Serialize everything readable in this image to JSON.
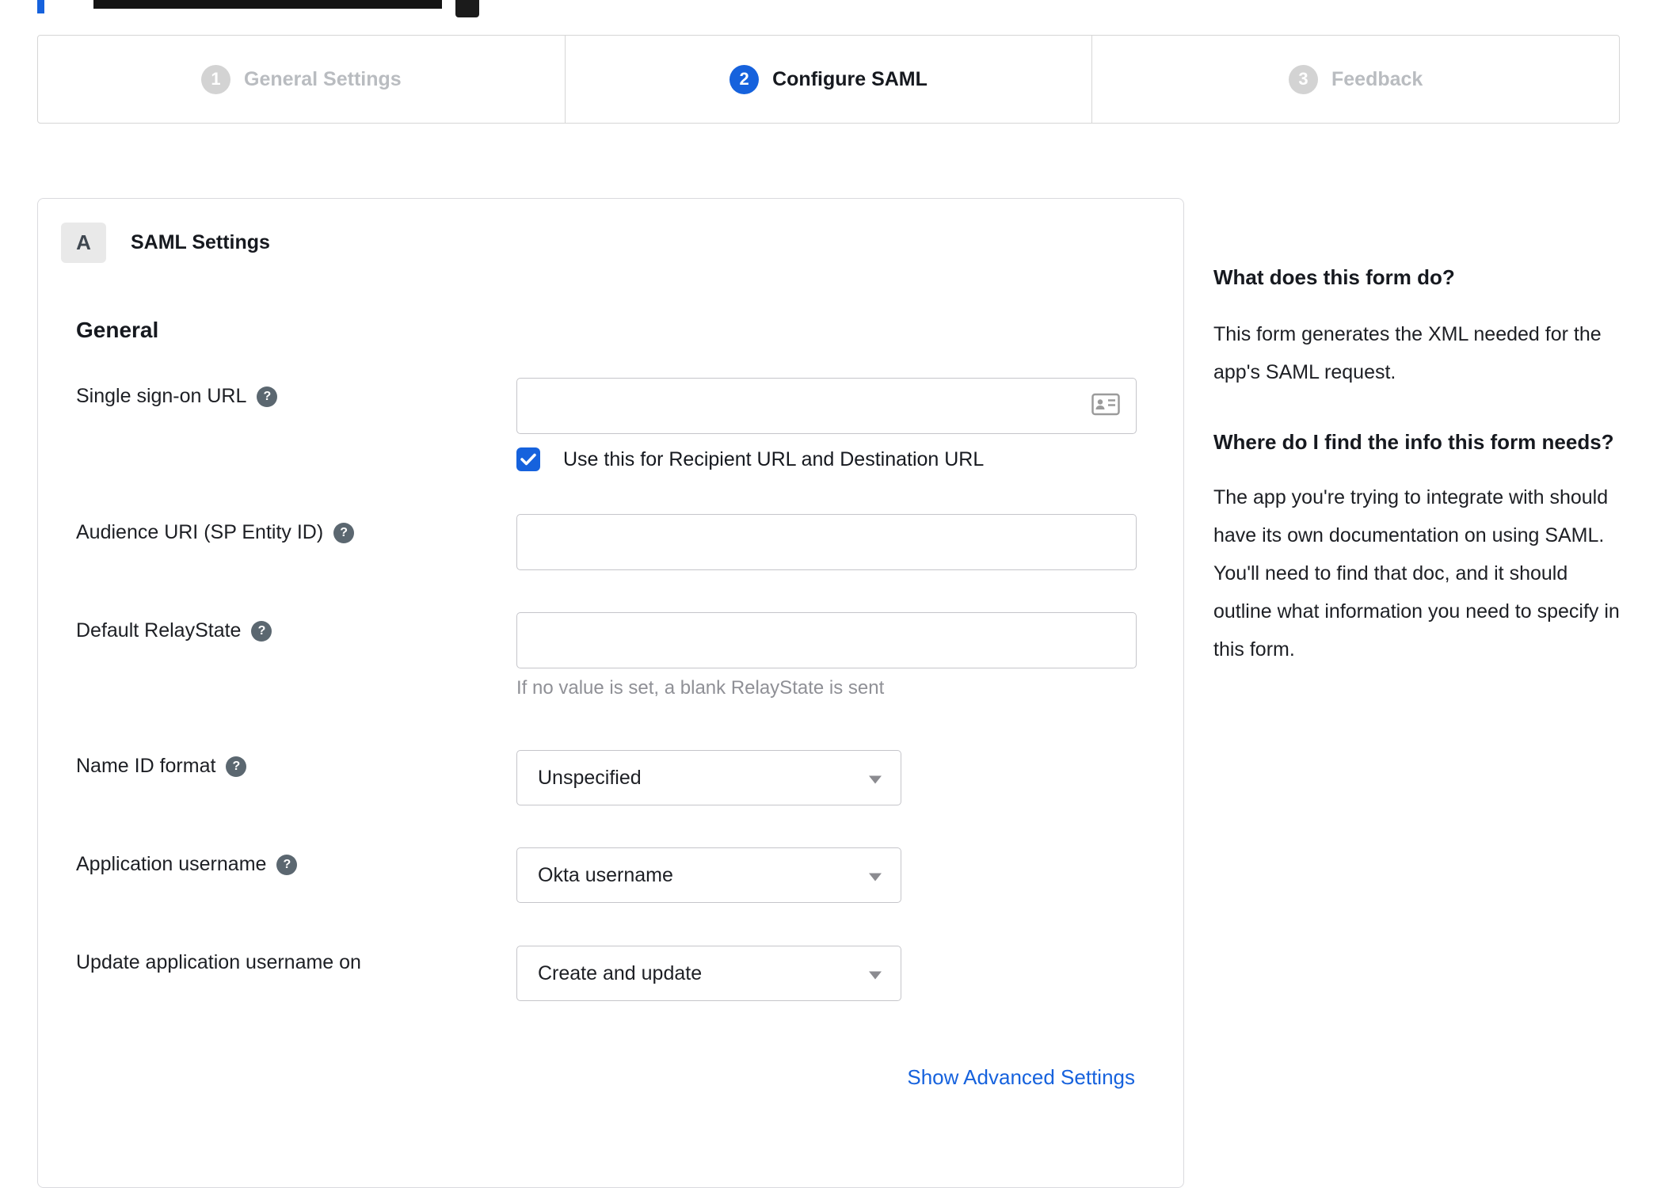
{
  "colors": {
    "accent": "#1662dd",
    "inactive_gray": "#b9bcc0"
  },
  "stepper": {
    "steps": [
      {
        "number": "1",
        "label": "General Settings",
        "active": false
      },
      {
        "number": "2",
        "label": "Configure SAML",
        "active": true
      },
      {
        "number": "3",
        "label": "Feedback",
        "active": false
      }
    ]
  },
  "panel": {
    "badge": "A",
    "title": "SAML Settings",
    "section": "General",
    "fields": {
      "sso": {
        "label": "Single sign-on URL",
        "value": "",
        "checkbox_label": "Use this for Recipient URL and Destination URL",
        "checked": true
      },
      "audience": {
        "label": "Audience URI (SP Entity ID)",
        "value": ""
      },
      "relay": {
        "label": "Default RelayState",
        "value": "",
        "hint": "If no value is set, a blank RelayState is sent"
      },
      "nameid": {
        "label": "Name ID format",
        "value": "Unspecified"
      },
      "appuser": {
        "label": "Application username",
        "value": "Okta username"
      },
      "update": {
        "label": "Update application username on",
        "value": "Create and update"
      }
    },
    "advanced_link": "Show Advanced Settings"
  },
  "sidebar": {
    "q1": "What does this form do?",
    "a1": "This form generates the XML needed for the app's SAML request.",
    "q2": "Where do I find the info this form needs?",
    "a2": "The app you're trying to integrate with should have its own documentation on using SAML. You'll need to find that doc, and it should outline what information you need to specify in this form."
  },
  "icons": {
    "help": "?",
    "card": "contact-card-icon",
    "check": "checkmark-icon",
    "caret": "chevron-down-icon"
  }
}
